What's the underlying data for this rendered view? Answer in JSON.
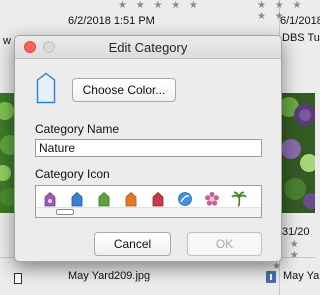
{
  "background": {
    "top_left_date": "6/2/2018 1:51 PM",
    "top_right_date": "6/1/2018",
    "right_partial_title": "DBS Tur",
    "left_partial_glyph": "w",
    "right_partial_date": "31/20",
    "bottom_left_filename": "May Yard209.jpg",
    "bottom_right_filename": "May Yard",
    "stars": "★ ★ ★ ★ ★"
  },
  "dialog": {
    "title": "Edit Category",
    "choose_color_label": "Choose Color...",
    "category_name_label": "Category Name",
    "category_name_value": "Nature",
    "category_icon_label": "Category Icon",
    "cancel_label": "Cancel",
    "ok_label": "OK",
    "swatch_color": "#e6f1fb",
    "category_icons": [
      {
        "name": "purple-flower-tag-icon",
        "color": "#9b5bb8"
      },
      {
        "name": "blue-tag-icon",
        "color": "#3a7fd0"
      },
      {
        "name": "green-tag-icon",
        "color": "#5aa33a"
      },
      {
        "name": "orange-tag-icon",
        "color": "#e07a2a"
      },
      {
        "name": "red-tag-icon",
        "color": "#c9374a"
      },
      {
        "name": "blue-ball-icon",
        "color": "#3f8fe0"
      },
      {
        "name": "pink-flower-icon",
        "color": "#d25d93"
      },
      {
        "name": "palm-tree-icon",
        "color": "#3c8a2e"
      }
    ]
  }
}
